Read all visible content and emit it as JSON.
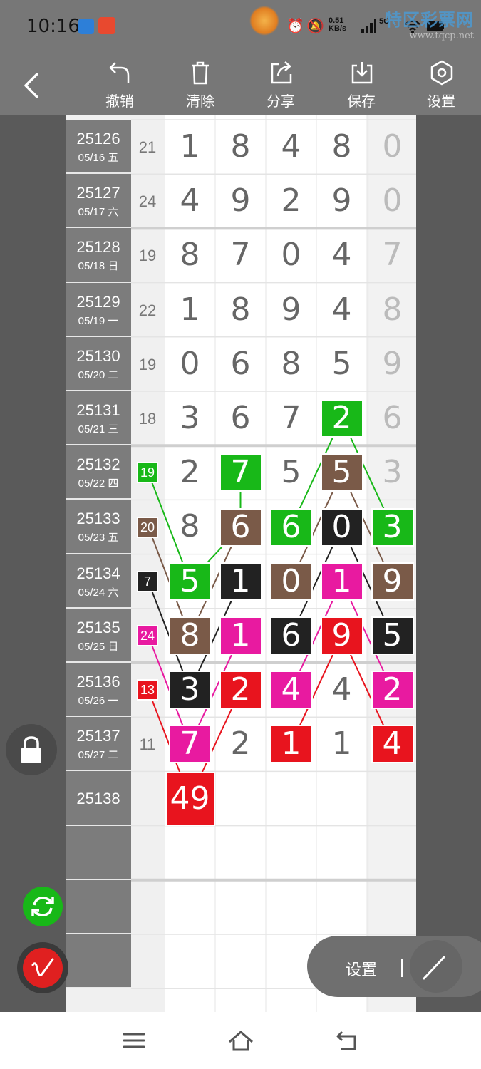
{
  "status_bar": {
    "time": "10:16",
    "net_speed_value": "0.51",
    "net_speed_unit": "KB/s",
    "network": "5G",
    "icons": [
      "app-icon-blue",
      "app-icon-red",
      "alarm-icon",
      "mute-icon",
      "signal-icon",
      "wifi-icon",
      "battery-icon"
    ]
  },
  "watermark": {
    "title": "特区彩票网",
    "url": "www.tqcp.net"
  },
  "toolbar": {
    "back_icon": "back-icon",
    "items": [
      {
        "label": "撤销",
        "icon": "undo-icon"
      },
      {
        "label": "清除",
        "icon": "trash-icon"
      },
      {
        "label": "分享",
        "icon": "share-icon"
      },
      {
        "label": "保存",
        "icon": "download-icon"
      },
      {
        "label": "设置",
        "icon": "settings-icon"
      }
    ]
  },
  "chart": {
    "rows": [
      {
        "issue": "25126",
        "date": "05/16 五",
        "sum": "21",
        "digits": [
          "1",
          "8",
          "4",
          "8",
          "0"
        ]
      },
      {
        "issue": "25127",
        "date": "05/17 六",
        "sum": "24",
        "digits": [
          "4",
          "9",
          "2",
          "9",
          "0"
        ]
      },
      {
        "issue": "25128",
        "date": "05/18 日",
        "sum": "19",
        "digits": [
          "8",
          "7",
          "0",
          "4",
          "7"
        ]
      },
      {
        "issue": "25129",
        "date": "05/19 一",
        "sum": "22",
        "digits": [
          "1",
          "8",
          "9",
          "4",
          "8"
        ]
      },
      {
        "issue": "25130",
        "date": "05/20 二",
        "sum": "19",
        "digits": [
          "0",
          "6",
          "8",
          "5",
          "9"
        ]
      },
      {
        "issue": "25131",
        "date": "05/21 三",
        "sum": "18",
        "digits": [
          "3",
          "6",
          "7",
          "2",
          "6"
        ]
      },
      {
        "issue": "25132",
        "date": "05/22 四",
        "sum": "19",
        "digits": [
          "2",
          "7",
          "5",
          "5",
          "3"
        ]
      },
      {
        "issue": "25133",
        "date": "05/23 五",
        "sum": "20",
        "digits": [
          "8",
          "6",
          "6",
          "0",
          "3"
        ]
      },
      {
        "issue": "25134",
        "date": "05/24 六",
        "sum": "7",
        "digits": [
          "5",
          "1",
          "0",
          "1",
          "9"
        ]
      },
      {
        "issue": "25135",
        "date": "05/25 日",
        "sum": "24",
        "digits": [
          "8",
          "1",
          "6",
          "9",
          "5"
        ]
      },
      {
        "issue": "25136",
        "date": "05/26 一",
        "sum": "13",
        "digits": [
          "3",
          "2",
          "4",
          "4",
          "2"
        ]
      },
      {
        "issue": "25137",
        "date": "05/27 二",
        "sum": "11",
        "digits": [
          "7",
          "2",
          "1",
          "1",
          "4"
        ]
      },
      {
        "issue": "25138",
        "date": "",
        "sum": "",
        "digits": [
          "49",
          "",
          "",
          "",
          ""
        ]
      },
      {
        "issue": "",
        "date": "",
        "sum": "",
        "digits": [
          "",
          "",
          "",
          "",
          ""
        ]
      },
      {
        "issue": "",
        "date": "",
        "sum": "",
        "digits": [
          "",
          "",
          "",
          "",
          ""
        ]
      },
      {
        "issue": "",
        "date": "",
        "sum": "",
        "digits": [
          "",
          "",
          "",
          "",
          ""
        ]
      }
    ],
    "colors": {
      "green": "#18b818",
      "brown": "#7a5a48",
      "black": "#222222",
      "magenta": "#e81aa0",
      "red": "#e8141e"
    },
    "highlights": [
      {
        "row": 5,
        "col": 3,
        "color": "green"
      },
      {
        "row": 6,
        "col": 1,
        "color": "green"
      },
      {
        "row": 6,
        "col": 3,
        "color": "brown"
      },
      {
        "row": 7,
        "col": 1,
        "color": "brown"
      },
      {
        "row": 7,
        "col": 2,
        "color": "green"
      },
      {
        "row": 7,
        "col": 3,
        "color": "black"
      },
      {
        "row": 7,
        "col": 4,
        "color": "green"
      },
      {
        "row": 8,
        "col": 0,
        "color": "green"
      },
      {
        "row": 8,
        "col": 1,
        "color": "black"
      },
      {
        "row": 8,
        "col": 2,
        "color": "brown"
      },
      {
        "row": 8,
        "col": 3,
        "color": "magenta"
      },
      {
        "row": 8,
        "col": 4,
        "color": "brown"
      },
      {
        "row": 9,
        "col": 0,
        "color": "brown"
      },
      {
        "row": 9,
        "col": 1,
        "color": "magenta"
      },
      {
        "row": 9,
        "col": 2,
        "color": "black"
      },
      {
        "row": 9,
        "col": 3,
        "color": "red"
      },
      {
        "row": 9,
        "col": 4,
        "color": "black"
      },
      {
        "row": 10,
        "col": 0,
        "color": "black"
      },
      {
        "row": 10,
        "col": 1,
        "color": "red"
      },
      {
        "row": 10,
        "col": 2,
        "color": "magenta"
      },
      {
        "row": 10,
        "col": 4,
        "color": "magenta"
      },
      {
        "row": 11,
        "col": 0,
        "color": "magenta"
      },
      {
        "row": 11,
        "col": 2,
        "color": "red"
      },
      {
        "row": 11,
        "col": 4,
        "color": "red"
      },
      {
        "row": 12,
        "col": 0,
        "color": "red"
      }
    ],
    "sum_highlights": [
      {
        "row": 6,
        "color": "green"
      },
      {
        "row": 7,
        "color": "brown"
      },
      {
        "row": 8,
        "color": "black"
      },
      {
        "row": 9,
        "color": "magenta"
      },
      {
        "row": 10,
        "color": "red"
      }
    ],
    "lines": [
      {
        "color": "green",
        "path": [
          [
            8,
            0
          ],
          [
            7,
            1
          ],
          [
            6,
            1
          ]
        ]
      },
      {
        "color": "green",
        "path": [
          [
            8,
            0
          ],
          [
            6,
            -1
          ]
        ]
      },
      {
        "color": "green",
        "path": [
          [
            7,
            2
          ],
          [
            5,
            3
          ],
          [
            7,
            4
          ]
        ]
      },
      {
        "color": "brown",
        "path": [
          [
            9,
            0
          ],
          [
            7,
            -1
          ]
        ]
      },
      {
        "color": "brown",
        "path": [
          [
            9,
            0
          ],
          [
            7,
            1
          ]
        ]
      },
      {
        "color": "brown",
        "path": [
          [
            8,
            2
          ],
          [
            6,
            3
          ],
          [
            8,
            4
          ]
        ]
      },
      {
        "color": "black",
        "path": [
          [
            10,
            0
          ],
          [
            8,
            -1
          ]
        ]
      },
      {
        "color": "black",
        "path": [
          [
            10,
            0
          ],
          [
            8,
            1
          ]
        ]
      },
      {
        "color": "black",
        "path": [
          [
            9,
            2
          ],
          [
            7,
            3
          ],
          [
            9,
            4
          ]
        ]
      },
      {
        "color": "magenta",
        "path": [
          [
            11,
            0
          ],
          [
            9,
            -1
          ]
        ]
      },
      {
        "color": "magenta",
        "path": [
          [
            11,
            0
          ],
          [
            9,
            1
          ]
        ]
      },
      {
        "color": "magenta",
        "path": [
          [
            10,
            2
          ],
          [
            8,
            3
          ],
          [
            10,
            4
          ]
        ]
      },
      {
        "color": "red",
        "path": [
          [
            12,
            0
          ],
          [
            10,
            -1
          ]
        ]
      },
      {
        "color": "red",
        "path": [
          [
            12,
            0
          ],
          [
            10,
            1
          ]
        ]
      },
      {
        "color": "red",
        "path": [
          [
            11,
            2
          ],
          [
            9,
            3
          ],
          [
            11,
            4
          ]
        ]
      }
    ]
  },
  "floating": {
    "lock_icon": "lock-icon",
    "refresh_icon": "refresh-icon",
    "pen_icon": "pen-icon",
    "settings_label": "设置",
    "draw_icon": "line-draw-icon"
  },
  "navbar": {
    "icons": [
      "menu-icon",
      "home-icon",
      "back-nav-icon"
    ]
  }
}
